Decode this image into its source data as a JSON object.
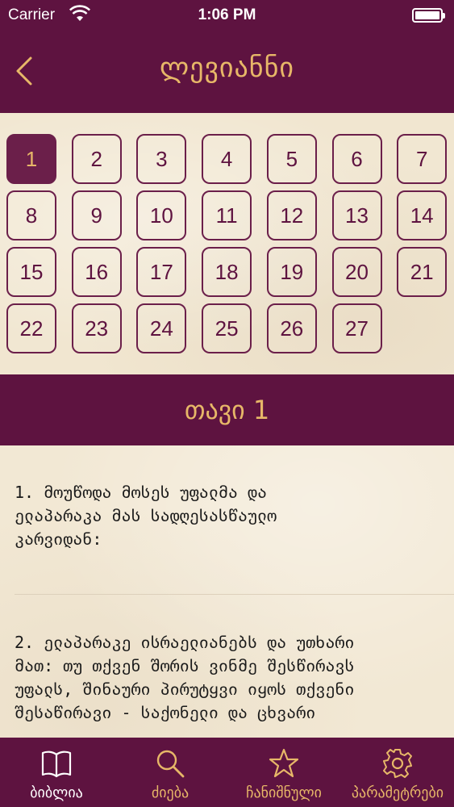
{
  "status_bar": {
    "carrier": "Carrier",
    "time": "1:06 PM",
    "battery_level": 1.0
  },
  "nav": {
    "title": "ლევიანნი",
    "back_icon": "chevron-left-icon"
  },
  "chapters": {
    "selected": "1",
    "items": [
      "1",
      "2",
      "3",
      "4",
      "5",
      "6",
      "7",
      "8",
      "9",
      "10",
      "11",
      "12",
      "13",
      "14",
      "15",
      "16",
      "17",
      "18",
      "19",
      "20",
      "21",
      "22",
      "23",
      "24",
      "25",
      "26",
      "27"
    ]
  },
  "section": {
    "title": "თავი 1"
  },
  "verses": [
    {
      "number": "1.",
      "lines": [
        "1.  მოუწოდა მოსეს უფალმა და",
        "ელაპარაკა მას სადღესასწაულო",
        "კარვიდან:"
      ]
    },
    {
      "number": "2.",
      "lines": [
        "2.  ელაპარაკე ისრაელიანებს და უთხარი",
        "მათ: თუ თქვენ შორის ვინმე შესწირავს",
        "უფალს, შინაური პირუტყვი იყოს თქვენი",
        "შესაწირავი - საქონელი და ცხვარი"
      ]
    }
  ],
  "tabs": [
    {
      "label": "ბიბლია",
      "icon": "book-icon",
      "active": true
    },
    {
      "label": "ძიება",
      "icon": "search-icon",
      "active": false
    },
    {
      "label": "ჩანიშნული",
      "icon": "star-icon",
      "active": false
    },
    {
      "label": "პარამეტრები",
      "icon": "gear-icon",
      "active": false
    }
  ],
  "colors": {
    "brand": "#5e1340",
    "accent": "#e7b768",
    "paper": "#f1e6d0",
    "tab_active": "#ffffff",
    "tab_inactive": "#e7b768"
  }
}
